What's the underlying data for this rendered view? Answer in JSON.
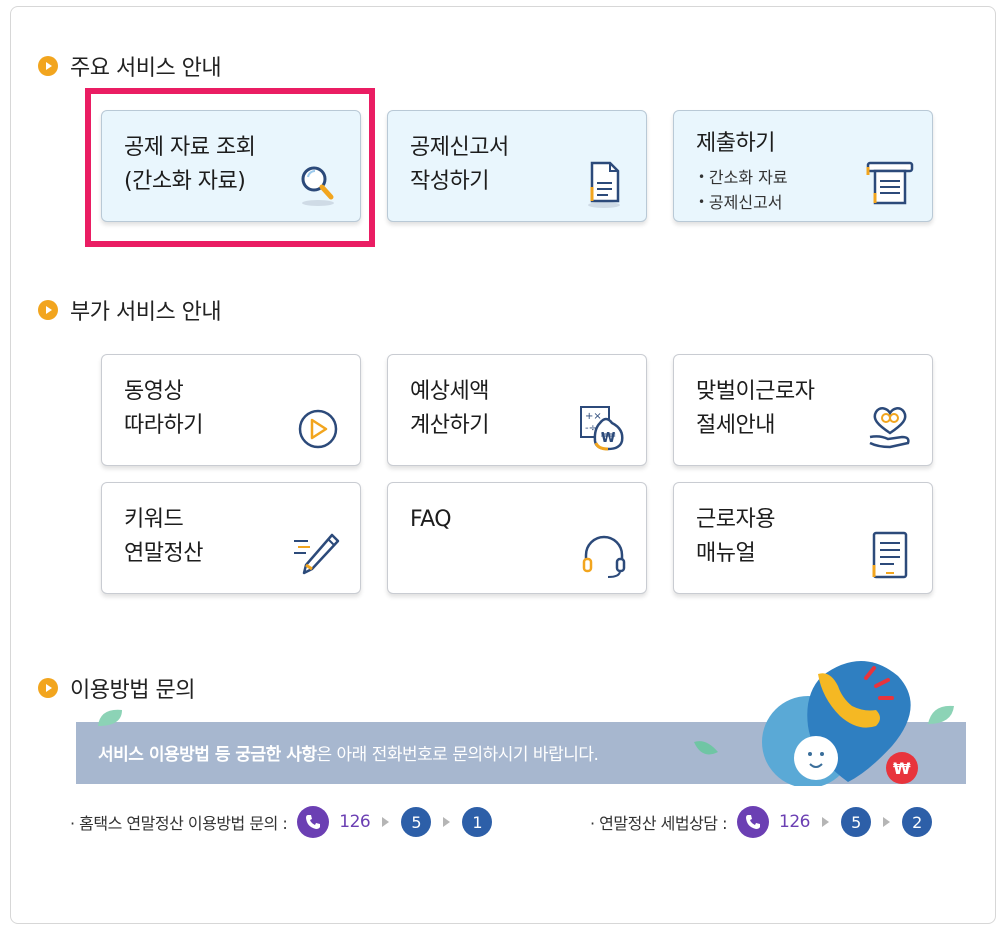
{
  "sections": {
    "main": "주요 서비스 안내",
    "extra": "부가 서비스 안내",
    "inquiry": "이용방법 문의"
  },
  "main_cards": [
    {
      "title": "공제 자료 조회\n(간소화 자료)",
      "icon": "search-icon"
    },
    {
      "title": "공제신고서\n작성하기",
      "icon": "document-icon"
    },
    {
      "title": "제출하기",
      "items": [
        "간소화 자료",
        "공제신고서"
      ],
      "icon": "submit-tray-icon"
    }
  ],
  "extra_cards": [
    {
      "title": "동영상\n따라하기",
      "icon": "play-circle-icon"
    },
    {
      "title": "예상세액\n계산하기",
      "icon": "calculator-money-bag-icon"
    },
    {
      "title": "맞벌이근로자\n절세안내",
      "icon": "heart-hand-icon"
    },
    {
      "title": "키워드\n연말정산",
      "icon": "pen-icon"
    },
    {
      "title": "FAQ",
      "icon": "headset-icon"
    },
    {
      "title": "근로자용\n매뉴얼",
      "icon": "manual-icon"
    }
  ],
  "banner": {
    "bold": "서비스 이용방법 등 궁금한 사항",
    "rest": "은 아래 전화번호로 문의하시기 바랍니다."
  },
  "contacts": [
    {
      "label": "· 홈택스 연말정산 이용방법 문의 :",
      "number": "126",
      "steps": [
        "5",
        "1"
      ]
    },
    {
      "label": "· 연말정산 세법상담 :",
      "number": "126",
      "steps": [
        "5",
        "2"
      ]
    }
  ],
  "colors": {
    "highlight": "#ea1d63",
    "bullet": "#f2a51e",
    "main_card_bg": "#e9f6fd",
    "banner": "#a7b7cf",
    "phone": "#6b3fb3",
    "step": "#2d5fa8"
  }
}
